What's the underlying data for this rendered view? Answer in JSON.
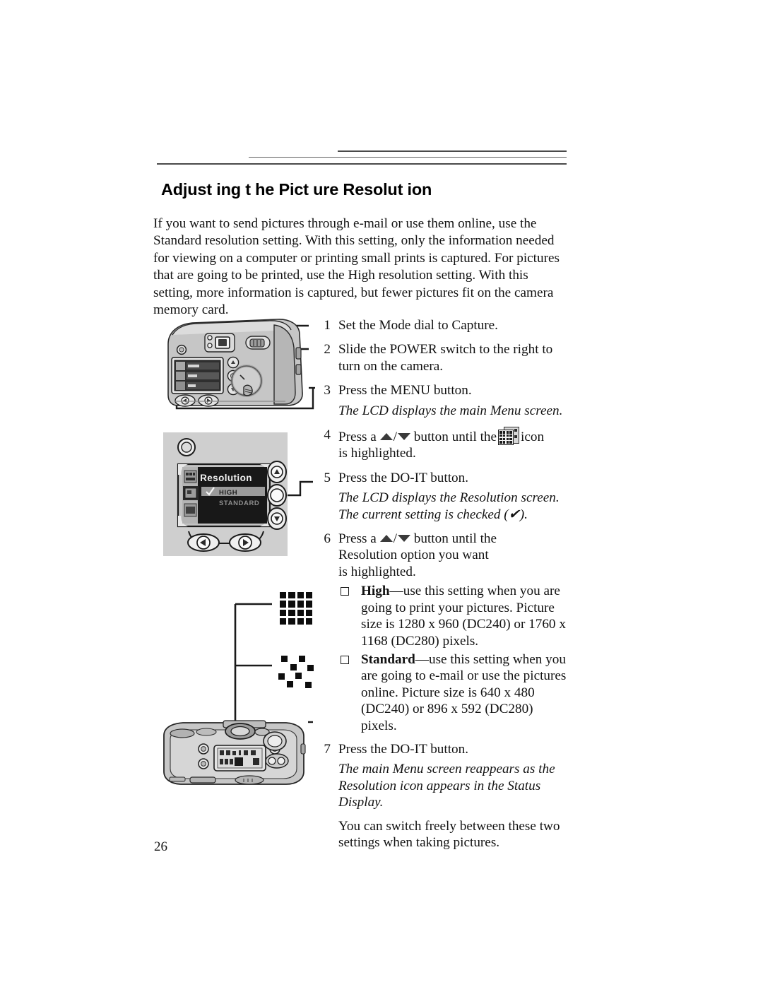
{
  "page": {
    "number": "26",
    "title": "Adjust ing t he Pict ure Resolut ion"
  },
  "intro": "If you want to send pictures through e-mail or use them online, use the Standard resolution setting. With this setting, only the information needed for viewing on a computer or printing small prints is captured. For pictures that are going to be printed, use the High resolution setting. With this setting, more information is captured, but fewer pictures fit on the camera memory card.",
  "steps": [
    {
      "num": "1",
      "text": "Set the Mode dial to Capture."
    },
    {
      "num": "2",
      "text": "Slide the POWER switch to the right to turn on the camera."
    },
    {
      "num": "3",
      "text": "Press the MENU button."
    },
    {
      "num": "5",
      "text": "Press the DO-IT button."
    },
    {
      "num": "7",
      "text": "Press the DO-IT button."
    }
  ],
  "step3_note": "The LCD displays the main Menu screen.",
  "step4": {
    "num": "4",
    "prefix": "Press a",
    "middle": "button until the",
    "suffix": "icon",
    "line2": "is highlighted."
  },
  "step5_note": "The LCD displays the Resolution screen. The current setting is checked (✔).",
  "step6": {
    "num": "6",
    "prefix": "Press a",
    "middle": "button until the",
    "line2": "Resolution option you want",
    "line3": "is highlighted."
  },
  "bullets": [
    {
      "term": "High",
      "dash": "—",
      "text": "use this setting when you are going to print your pictures. Picture size is 1280 x 960 (DC240) or 1760 x 1168 (DC280) pixels."
    },
    {
      "term": "Standard",
      "dash": "—",
      "text": "use this setting when you are going to e-mail or use the pictures online. Picture size is 640 x 480 (DC240) or 896 x 592 (DC280) pixels."
    }
  ],
  "step7_note": "The main Menu screen reappears as the Resolution icon appears in the Status Display.",
  "closing": "You can switch freely between these two settings when taking pictures.",
  "lcd_screen": {
    "title": "Resolution",
    "options": [
      {
        "label": "HIGH",
        "checked": true,
        "highlighted": true
      },
      {
        "label": "STANDARD",
        "checked": false,
        "highlighted": false
      }
    ]
  },
  "callouts": {
    "mode_dial": "1",
    "power_switch": "2",
    "menu_button": "3",
    "do_it_button": "5",
    "status_display": "7"
  },
  "colors": {
    "text": "#131313",
    "rule": "#4a4a4a",
    "camera_body": "#c9c9c9",
    "lcd_dark": "#1b1b1b",
    "lcd_highlight": "#9a9a9a"
  }
}
